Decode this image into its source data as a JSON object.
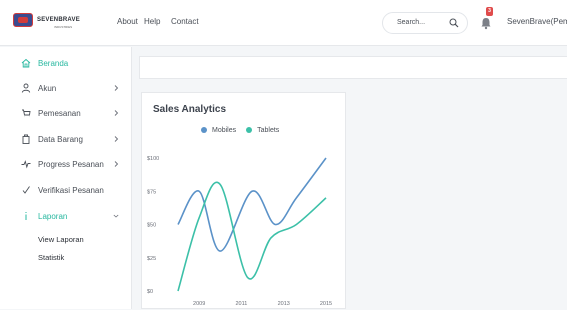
{
  "header": {
    "logo_text": "SEVENBRAVE",
    "logo_sub": "INDUSTRIES",
    "nav": [
      "About",
      "Help",
      "Contact"
    ],
    "search_placeholder": "Search...",
    "notification_count": "3",
    "username": "SevenBrave(Pemilik)"
  },
  "sidebar": {
    "items": [
      {
        "label": "Beranda",
        "icon": "home-icon",
        "active": true
      },
      {
        "label": "Akun",
        "icon": "user-icon",
        "has_chevron": true
      },
      {
        "label": "Pemesanan",
        "icon": "cart-icon",
        "has_chevron": true
      },
      {
        "label": "Data Barang",
        "icon": "box-icon",
        "has_chevron": true
      },
      {
        "label": "Progress Pesanan",
        "icon": "pulse-icon",
        "has_chevron": true
      },
      {
        "label": "Verifikasi Pesanan",
        "icon": "check-icon"
      },
      {
        "label": "Laporan",
        "icon": "info-icon",
        "active": true,
        "expanded": true
      }
    ],
    "subitems": [
      "View Laporan",
      "Statistik"
    ]
  },
  "colors": {
    "accent": "#28b8a0",
    "mobiles": "#5b92c8",
    "tablets": "#3cc0a8"
  },
  "chart_card": {
    "title": "Sales Analytics"
  },
  "chart_data": {
    "type": "line",
    "title": "Sales Analytics",
    "x_ticks": [
      "2009",
      "2011",
      "2013",
      "2015"
    ],
    "xlim": [
      2008,
      2015
    ],
    "ylim": [
      0,
      100
    ],
    "y_ticks": [
      "$0",
      "$25",
      "$50",
      "$75",
      "$100"
    ],
    "legend_position": "top",
    "series": [
      {
        "name": "Mobiles",
        "color": "#5b92c8",
        "x": [
          2008,
          2009,
          2010,
          2011.5,
          2012.6,
          2013.6,
          2015
        ],
        "values": [
          50,
          75,
          30,
          75,
          50,
          70,
          100
        ]
      },
      {
        "name": "Tablets",
        "color": "#3cc0a8",
        "x": [
          2008,
          2009,
          2010,
          2011.3,
          2012.4,
          2013.6,
          2015
        ],
        "values": [
          0,
          55,
          80,
          10,
          40,
          50,
          70
        ]
      }
    ]
  }
}
